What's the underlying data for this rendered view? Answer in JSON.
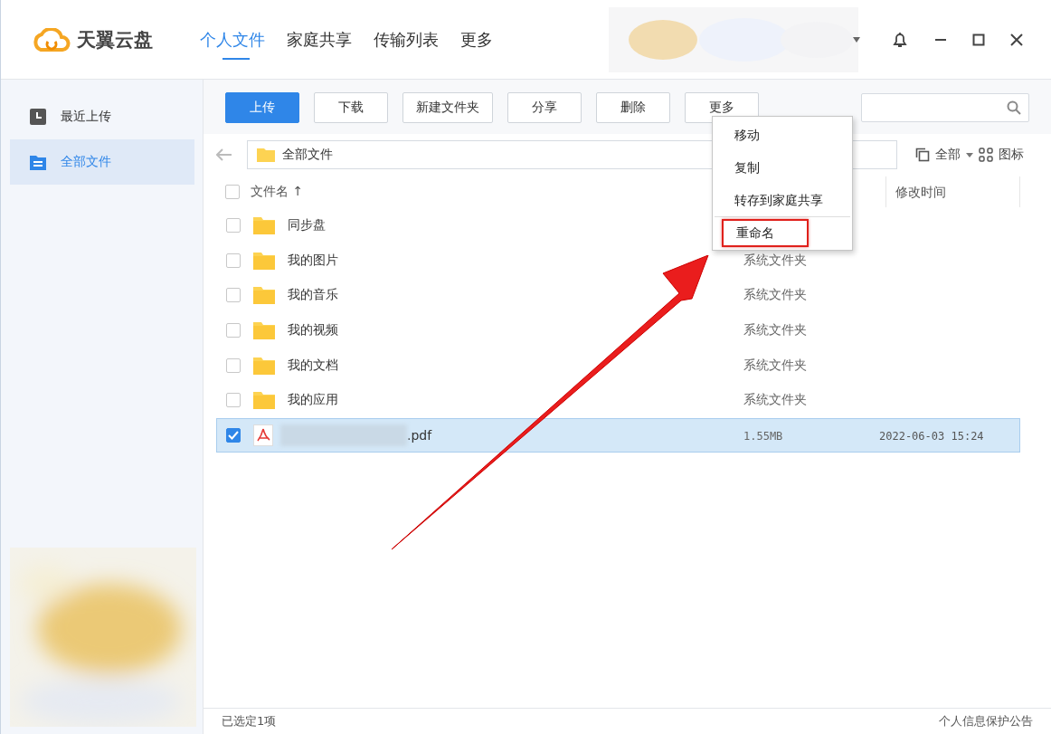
{
  "app": {
    "name": "天翼云盘"
  },
  "nav_tabs": [
    {
      "label": "个人文件",
      "selected": true
    },
    {
      "label": "家庭共享",
      "selected": false
    },
    {
      "label": "传输列表",
      "selected": false
    },
    {
      "label": "更多",
      "selected": false
    }
  ],
  "sidebar": {
    "items": [
      {
        "label": "最近上传",
        "selected": false,
        "kind": "recent"
      },
      {
        "label": "全部文件",
        "selected": true,
        "kind": "all"
      }
    ]
  },
  "toolbar": {
    "buttons": [
      {
        "label": "上传",
        "primary": true
      },
      {
        "label": "下载",
        "primary": false
      },
      {
        "label": "新建文件夹",
        "primary": false
      },
      {
        "label": "分享",
        "primary": false
      },
      {
        "label": "删除",
        "primary": false
      },
      {
        "label": "更多",
        "primary": false
      }
    ]
  },
  "path": {
    "current": "全部文件"
  },
  "view": {
    "filter": "全部",
    "mode": "图标"
  },
  "table": {
    "select_all_checked": false,
    "columns": [
      "文件名 ↑",
      "修改时间"
    ],
    "rows": [
      {
        "kind": "folder",
        "name": "同步盘",
        "info": "",
        "modified": "",
        "checked": false,
        "selected": false
      },
      {
        "kind": "folder",
        "name": "我的图片",
        "info": "系统文件夹",
        "modified": "",
        "checked": false,
        "selected": false
      },
      {
        "kind": "folder",
        "name": "我的音乐",
        "info": "系统文件夹",
        "modified": "",
        "checked": false,
        "selected": false
      },
      {
        "kind": "folder",
        "name": "我的视频",
        "info": "系统文件夹",
        "modified": "",
        "checked": false,
        "selected": false
      },
      {
        "kind": "folder",
        "name": "我的文档",
        "info": "系统文件夹",
        "modified": "",
        "checked": false,
        "selected": false
      },
      {
        "kind": "folder",
        "name": "我的应用",
        "info": "系统文件夹",
        "modified": "",
        "checked": false,
        "selected": false
      },
      {
        "kind": "pdf",
        "name": ".pdf",
        "info": "1.55MB",
        "modified": "2022-06-03 15:24",
        "checked": true,
        "selected": true
      }
    ]
  },
  "context_menu": {
    "items": [
      {
        "label": "移动",
        "highlighted": false,
        "divider_before": false
      },
      {
        "label": "复制",
        "highlighted": false,
        "divider_before": false
      },
      {
        "label": "转存到家庭共享",
        "highlighted": false,
        "divider_before": false
      },
      {
        "label": "重命名",
        "highlighted": true,
        "divider_before": true
      }
    ]
  },
  "status_bar": {
    "selection": "已选定1项",
    "link": "个人信息保护公告"
  }
}
